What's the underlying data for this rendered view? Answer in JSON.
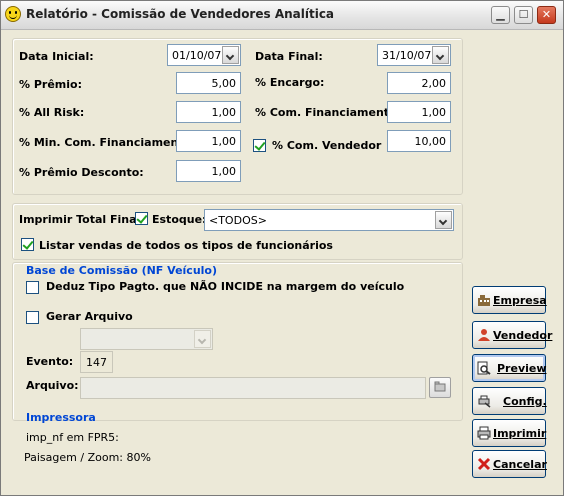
{
  "window": {
    "title": "Relatório - Comissão de Vendedores Analítica",
    "minimize_icon": "minimize-icon",
    "maximize_icon": "maximize-icon",
    "close_icon": "close-icon",
    "app_icon": "smiley-icon"
  },
  "dates": {
    "start_label": "Data Inicial:",
    "start_value": "01/10/07",
    "end_label": "Data Final:",
    "end_value": "31/10/07"
  },
  "fields": {
    "premio_label": "% Prêmio:",
    "premio_value": "5,00",
    "encargo_label": "% Encargo:",
    "encargo_value": "2,00",
    "allrisk_label": "% All Risk:",
    "allrisk_value": "1,00",
    "com_fin_label": "% Com. Financiamento:",
    "com_fin_value": "1,00",
    "min_com_fin_label": "% Min. Com. Financiamento:",
    "min_com_fin_value": "1,00",
    "com_vend_label": "% Com. Vendedor",
    "com_vend_checked": true,
    "com_vend_value": "10,00",
    "premio_desc_label": "% Prêmio Desconto:",
    "premio_desc_value": "1,00"
  },
  "options": {
    "imprimir_total_label": "Imprimir Total Final",
    "estoque_label": "Estoque:",
    "estoque_checked": true,
    "estoque_value": "<TODOS>",
    "listar_label": "Listar vendas de todos os tipos de funcionários",
    "listar_checked": true
  },
  "base": {
    "section_title": "Base de Comissão (NF Veículo)",
    "deduz_label": "Deduz Tipo Pagto. que NÃO INCIDE na margem do veículo",
    "deduz_checked": false
  },
  "arquivo": {
    "gerar_label": "Gerar Arquivo",
    "gerar_checked": false,
    "format_value": "",
    "evento_label": "Evento:",
    "evento_value": "147",
    "arquivo_label": "Arquivo:",
    "arquivo_value": "",
    "browse_icon": "folder-browse-icon"
  },
  "printer": {
    "section_title": "Impressora",
    "line1": "imp_nf em FPR5:",
    "line2": "Paisagem / Zoom: 80%"
  },
  "buttons": {
    "empresa": "Empresa",
    "vendedor": "Vendedor",
    "preview": "Preview",
    "config": "Config.",
    "imprimir": "Imprimir",
    "cancelar": "Cancelar"
  }
}
